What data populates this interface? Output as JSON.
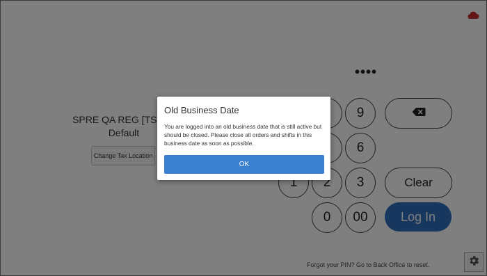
{
  "store": {
    "name": "SPRE QA REG [TS][AS",
    "subtitle": "Default",
    "change_tax_label": "Change Tax Location"
  },
  "pin": {
    "masked_value": "••••"
  },
  "keypad": {
    "keys": [
      "9",
      "6",
      "1",
      "2",
      "3",
      "0",
      "00"
    ],
    "clear_label": "Clear",
    "login_label": "Log In"
  },
  "footer": {
    "forgot_text": "Forgot your PIN? Go to Back Office to reset."
  },
  "dialog": {
    "title": "Old Business Date",
    "message": "You are logged into an old business date that is still active but should be closed. Please close all orders and shifts in this business date as soon as possible.",
    "ok_label": "OK"
  },
  "colors": {
    "accent": "#3a7fd0",
    "login": "#2f6fbd",
    "cloud": "#c62828"
  },
  "icons": {
    "cloud": "cloud-icon",
    "backspace": "backspace-icon",
    "settings": "gear-icon"
  }
}
